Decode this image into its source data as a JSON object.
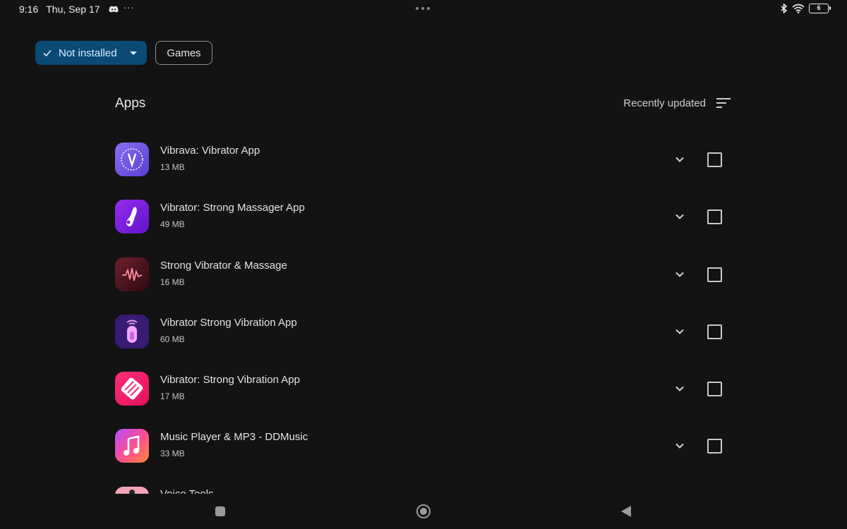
{
  "status_bar": {
    "time": "9:16",
    "date": "Thu, Sep 17",
    "more": "···",
    "battery": "6"
  },
  "filters": {
    "primary_label": "Not installed",
    "secondary_label": "Games"
  },
  "header": {
    "title": "Apps",
    "sort_label": "Recently updated"
  },
  "apps": [
    {
      "name": "Vibrava: Vibrator App",
      "size": "13 MB",
      "icon": "vibrava-icon"
    },
    {
      "name": "Vibrator: Strong Massager App",
      "size": "49 MB",
      "icon": "vibrator-massager-icon"
    },
    {
      "name": "Strong Vibrator & Massage",
      "size": "16 MB",
      "icon": "strong-vibrator-icon"
    },
    {
      "name": "Vibrator Strong Vibration App",
      "size": "60 MB",
      "icon": "vibration-app-icon"
    },
    {
      "name": "Vibrator: Strong Vibration App",
      "size": "17 MB",
      "icon": "strong-vibration-icon"
    },
    {
      "name": "Music Player & MP3 - DDMusic",
      "size": "33 MB",
      "icon": "music-player-icon"
    },
    {
      "name": "Voice Tools",
      "size": "",
      "icon": "voice-tools-icon"
    }
  ],
  "colors": {
    "background": "#131313",
    "chip_selected": "#0b4a75",
    "text_primary": "#e3e3e3"
  }
}
